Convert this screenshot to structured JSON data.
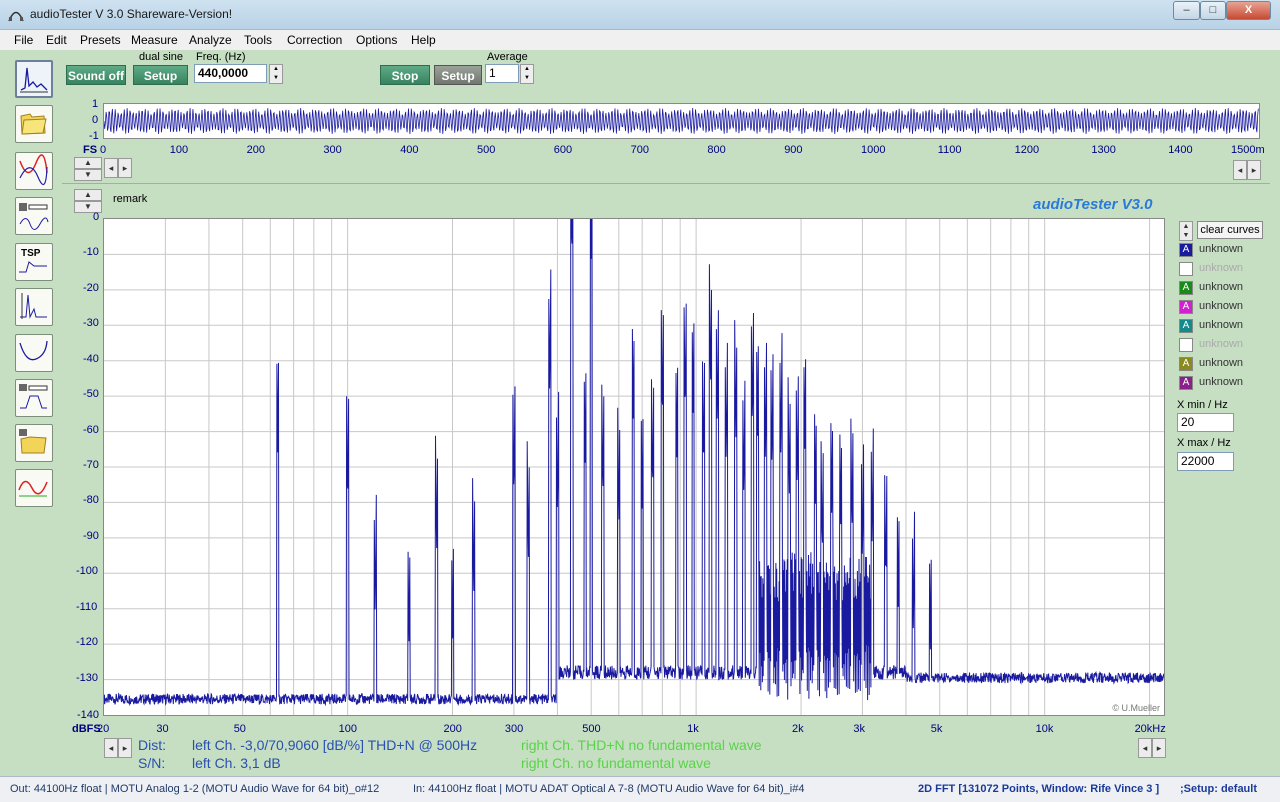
{
  "window": {
    "title": "audioTester  V 3.0 Shareware-Version!",
    "min": "–",
    "max": "□",
    "close": "X"
  },
  "menu": [
    "File",
    "Edit",
    "Presets",
    "Measure",
    "Analyze",
    "Tools",
    "Correction",
    "Options",
    "Help"
  ],
  "controls": {
    "sound_off": "Sound off",
    "dual_sine": "dual sine",
    "setup": "Setup",
    "freq_label": "Freq. (Hz)",
    "freq_value": "440,0000",
    "stop": "Stop",
    "setup2": "Setup",
    "average_label": "Average",
    "average_value": "1"
  },
  "waveform": {
    "y_ticks": [
      "1",
      "0",
      "-1"
    ],
    "fs_label": "FS",
    "x_ticks": [
      "0",
      "100",
      "200",
      "300",
      "400",
      "500",
      "600",
      "700",
      "800",
      "900",
      "1000",
      "1100",
      "1200",
      "1300",
      "1400",
      "1500m"
    ]
  },
  "spectrum": {
    "remark_label": "remark",
    "brand": "audioTester  V3.0",
    "copyright": "© U.Mueller",
    "y_unit": "dBFS",
    "y_ticks": [
      "0",
      "-10",
      "-20",
      "-30",
      "-40",
      "-50",
      "-60",
      "-70",
      "-80",
      "-90",
      "-100",
      "-110",
      "-120",
      "-130",
      "-140"
    ],
    "x_ticks": [
      "20",
      "30",
      "50",
      "100",
      "200",
      "300",
      "500",
      "1k",
      "2k",
      "3k",
      "5k",
      "10k",
      "20kHz"
    ]
  },
  "legend": {
    "clear_curves": "clear curves",
    "items": [
      {
        "mark": "A",
        "label": "unknown",
        "color": "#1a1aa0",
        "enabled": true
      },
      {
        "mark": "",
        "label": "unknown",
        "color": "#ffffff",
        "enabled": false
      },
      {
        "mark": "A",
        "label": "unknown",
        "color": "#1a8a1a",
        "enabled": true
      },
      {
        "mark": "A",
        "label": "unknown",
        "color": "#d020d0",
        "enabled": true
      },
      {
        "mark": "A",
        "label": "unknown",
        "color": "#148a8a",
        "enabled": true
      },
      {
        "mark": "",
        "label": "unknown",
        "color": "#ffffff",
        "enabled": false
      },
      {
        "mark": "A",
        "label": "unknown",
        "color": "#8a8a20",
        "enabled": true
      },
      {
        "mark": "A",
        "label": "unknown",
        "color": "#8a208a",
        "enabled": true
      }
    ],
    "xmin_label": "X min / Hz",
    "xmin_value": "20",
    "xmax_label": "X max / Hz",
    "xmax_value": "22000"
  },
  "results": {
    "dist_label": "Dist:",
    "dist_left": "left Ch. -3,0/70,9060 [dB/%] THD+N  @ 500Hz",
    "dist_right": "right Ch. THD+N  no fundamental wave",
    "sn_label": "S/N:",
    "sn_left": "left Ch. 3,1 dB",
    "sn_right": "right Ch.  no fundamental wave"
  },
  "status": {
    "out": "Out: 44100Hz float  | MOTU Analog 1-2 (MOTU Audio Wave for 64 bit)_o#12",
    "in": "In: 44100Hz float  | MOTU ADAT Optical A 7-8 (MOTU Audio Wave for 64 bit)_i#4",
    "fft": "2D FFT [131072 Points, Window: Rife Vince 3 ]",
    "setup": ";Setup:  default"
  },
  "colors": {
    "trace": "#1a1aa0",
    "panel": "#c6dfc3",
    "accent_text": "#2a7ad8",
    "result_left": "#2a4fb0",
    "result_right": "#5ad24a"
  },
  "tools_icons": [
    "fft-tool-icon",
    "folder-open-icon",
    "frequency-response-icon",
    "scope-icon",
    "tsp-icon",
    "thd-icon",
    "impedance-icon",
    "filter-icon",
    "folder-compare-icon",
    "waveform-icon"
  ]
}
